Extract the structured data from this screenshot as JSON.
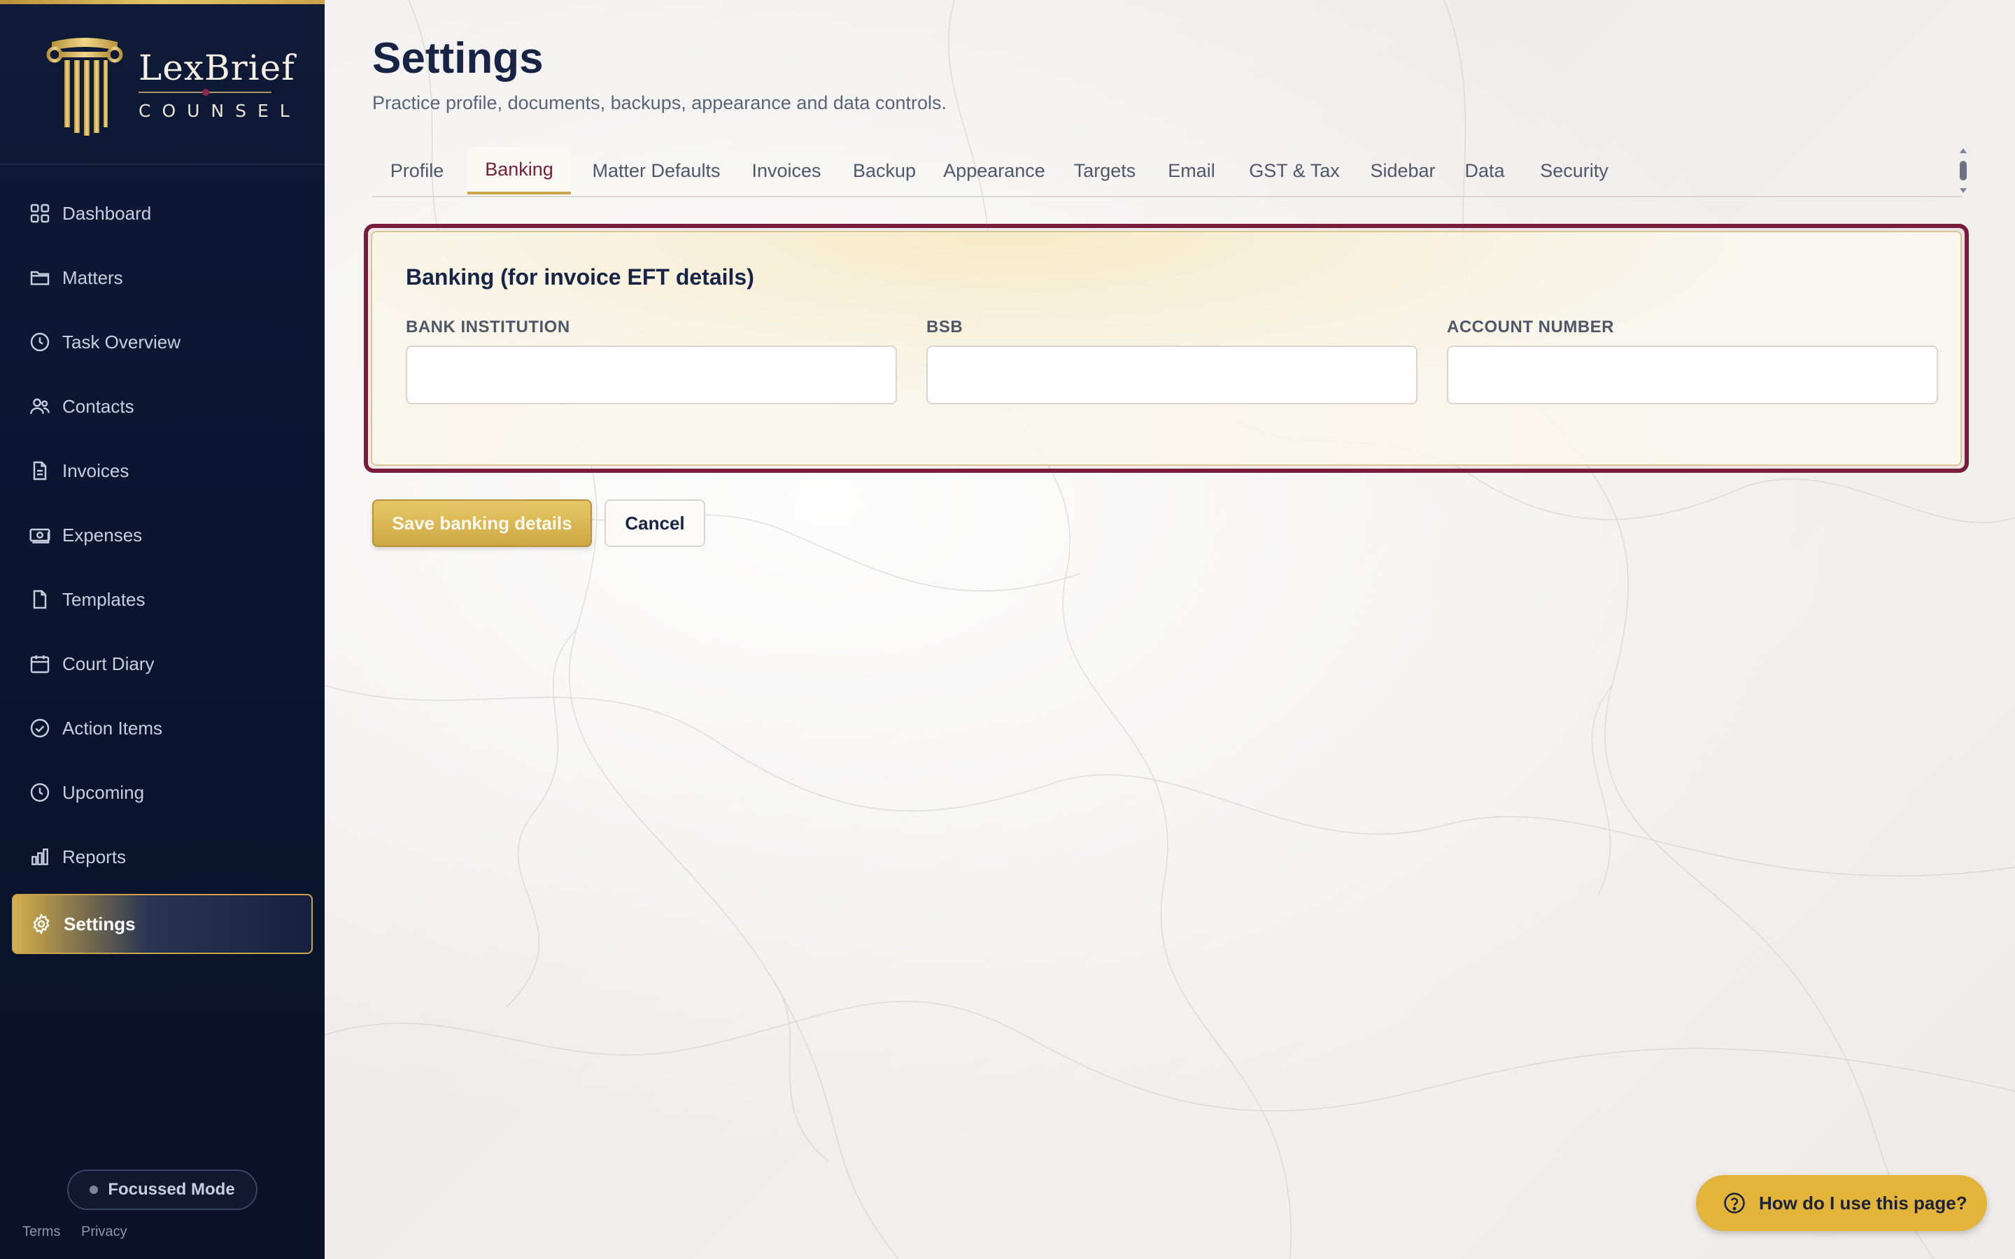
{
  "brand": {
    "name": "LexBrief",
    "subtitle": "COUNSEL"
  },
  "sidebar": {
    "items": [
      {
        "label": "Dashboard",
        "icon": "grid-icon"
      },
      {
        "label": "Matters",
        "icon": "folder-icon"
      },
      {
        "label": "Task Overview",
        "icon": "clock-icon"
      },
      {
        "label": "Contacts",
        "icon": "users-icon"
      },
      {
        "label": "Invoices",
        "icon": "file-text-icon"
      },
      {
        "label": "Expenses",
        "icon": "banknote-icon"
      },
      {
        "label": "Templates",
        "icon": "file-icon"
      },
      {
        "label": "Court Diary",
        "icon": "calendar-icon"
      },
      {
        "label": "Action Items",
        "icon": "check-circle-icon"
      },
      {
        "label": "Upcoming",
        "icon": "clock-icon"
      },
      {
        "label": "Reports",
        "icon": "bar-chart-icon"
      },
      {
        "label": "Settings",
        "icon": "gear-icon",
        "active": true
      }
    ],
    "focus_mode": "Focussed Mode",
    "footer": {
      "terms": "Terms",
      "privacy": "Privacy"
    }
  },
  "page": {
    "title": "Settings",
    "subtitle": "Practice profile, documents, backups, appearance and data controls."
  },
  "tabs": [
    {
      "label": "Profile"
    },
    {
      "label": "Banking",
      "active": true
    },
    {
      "label": "Matter Defaults"
    },
    {
      "label": "Invoices"
    },
    {
      "label": "Backup"
    },
    {
      "label": "Appearance"
    },
    {
      "label": "Targets"
    },
    {
      "label": "Email"
    },
    {
      "label": "GST & Tax"
    },
    {
      "label": "Sidebar"
    },
    {
      "label": "Data"
    },
    {
      "label": "Security"
    }
  ],
  "banking": {
    "title": "Banking (for invoice EFT details)",
    "fields": [
      {
        "label": "BANK INSTITUTION",
        "value": ""
      },
      {
        "label": "BSB",
        "value": ""
      },
      {
        "label": "ACCOUNT NUMBER",
        "value": ""
      }
    ],
    "save_label": "Save banking details",
    "cancel_label": "Cancel"
  },
  "help": {
    "label": "How do I use this page?"
  },
  "colors": {
    "sidebar_bg": "#0f1a36",
    "accent_gold": "#c9a44a",
    "accent_burgundy": "#7a1d3c",
    "title_navy": "#172446"
  }
}
